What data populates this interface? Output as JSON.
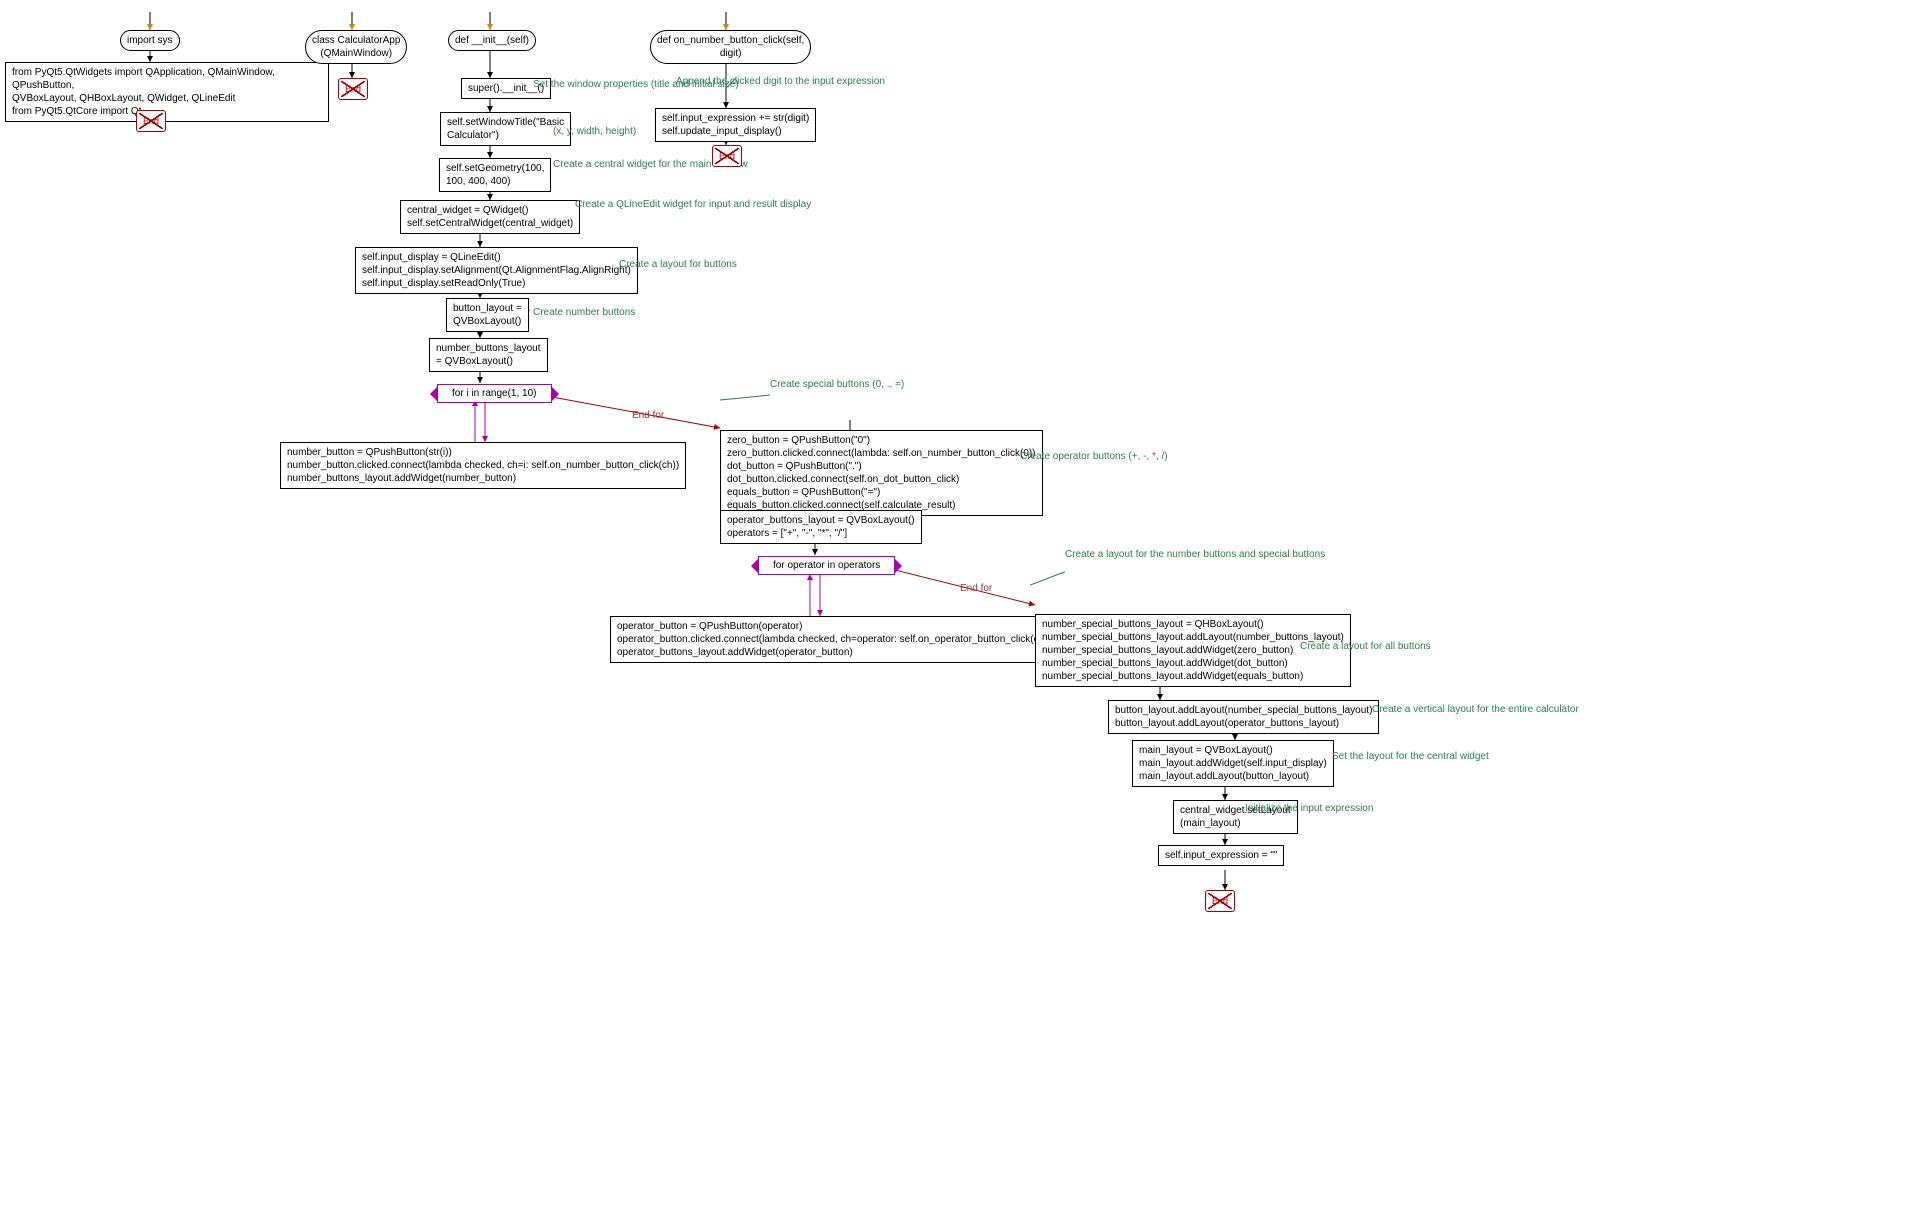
{
  "col1": {
    "start": "import sys",
    "imports": "from PyQt5.QtWidgets import QApplication, QMainWindow, QPushButton,\nQVBoxLayout, QHBoxLayout, QWidget, QLineEdit\nfrom PyQt5.QtCore import Qt",
    "end": "End"
  },
  "col2": {
    "start": "class CalculatorApp\n(QMainWindow)",
    "end": "End"
  },
  "col3": {
    "start": "def __init__(self)",
    "n1": "super().__init__()",
    "c1": "Set the window properties\n(title and initial size)",
    "n2": "self.setWindowTitle(\"Basic\nCalculator\")",
    "c2": "(x, y, width, height)",
    "n3": "self.setGeometry(100,\n100, 400, 400)",
    "c3": "Create a central widget\nfor the main window",
    "n4": "central_widget = QWidget()\nself.setCentralWidget(central_widget)",
    "c4": "Create a QLineEdit widget\nfor input and result\ndisplay",
    "n5": "self.input_display = QLineEdit()\nself.input_display.setAlignment(Qt.AlignmentFlag.AlignRight)\nself.input_display.setReadOnly(True)",
    "c5": "Create a layout\nfor buttons",
    "n6": "button_layout =\nQVBoxLayout()",
    "c6": "Create number buttons",
    "n7": "number_buttons_layout\n= QVBoxLayout()",
    "loop1": "for i in range(1, 10)",
    "body1": "number_button = QPushButton(str(i))\nnumber_button.clicked.connect(lambda checked, ch=i: self.on_number_button_click(ch))\nnumber_buttons_layout.addWidget(number_button)",
    "endfor1": "End for",
    "c7": "Create special\nbuttons (0, ., =)",
    "n8": "zero_button = QPushButton(\"0\")\nzero_button.clicked.connect(lambda: self.on_number_button_click(0))\ndot_button = QPushButton(\".\")\ndot_button.clicked.connect(self.on_dot_button_click)\nequals_button = QPushButton(\"=\")\nequals_button.clicked.connect(self.calculate_result)",
    "c8": "Create operator\nbuttons (+, -, *, /)",
    "n9": "operator_buttons_layout = QVBoxLayout()\noperators = [\"+\", \"-\", \"*\", \"/\"]",
    "loop2": "for operator in operators",
    "body2": "operator_button = QPushButton(operator)\noperator_button.clicked.connect(lambda checked, ch=operator: self.on_operator_button_click(ch))\noperator_buttons_layout.addWidget(operator_button)",
    "endfor2": "End for",
    "c9": "Create a layout for the\nnumber buttons and special\nbuttons",
    "n10": "number_special_buttons_layout = QHBoxLayout()\nnumber_special_buttons_layout.addLayout(number_buttons_layout)\nnumber_special_buttons_layout.addWidget(zero_button)\nnumber_special_buttons_layout.addWidget(dot_button)\nnumber_special_buttons_layout.addWidget(equals_button)",
    "c10": "Create a layout\nfor all buttons",
    "n11": "button_layout.addLayout(number_special_buttons_layout)\nbutton_layout.addLayout(operator_buttons_layout)",
    "c11": "Create a vertical layout\nfor the entire calculator",
    "n12": "main_layout = QVBoxLayout()\nmain_layout.addWidget(self.input_display)\nmain_layout.addLayout(button_layout)",
    "c12": "Set the layout for\nthe central widget",
    "n13": "central_widget.setLayout\n(main_layout)",
    "c13": "Initialize the\ninput expression",
    "n14": "self.input_expression = \"\"",
    "end": "End"
  },
  "col4": {
    "start": "def on_number_button_click(self,\ndigit)",
    "c1": "Append the clicked digit\nto the input expression",
    "n1": "self.input_expression += str(digit)\nself.update_input_display()",
    "end": "End"
  }
}
